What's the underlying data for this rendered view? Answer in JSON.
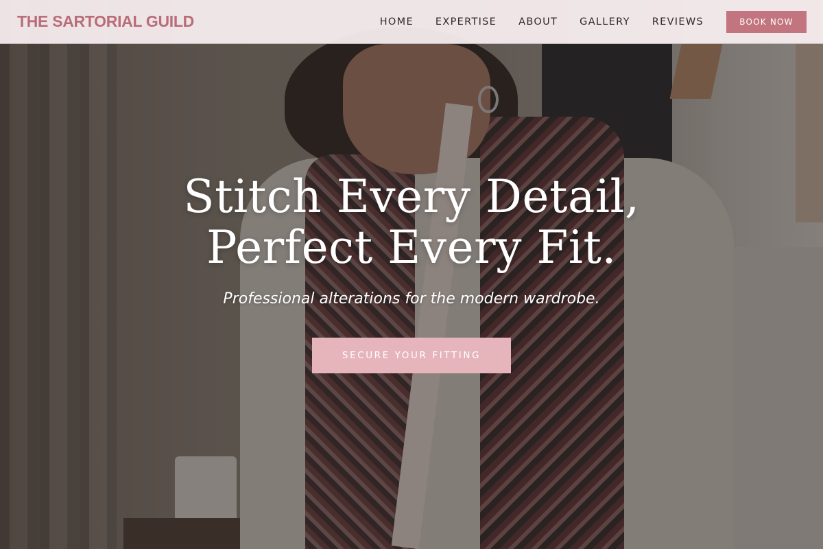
{
  "brand": {
    "name": "THE SARTORIAL GUILD",
    "color": "#b86d78"
  },
  "nav": {
    "items": [
      {
        "label": "HOME"
      },
      {
        "label": "EXPERTISE"
      },
      {
        "label": "ABOUT"
      },
      {
        "label": "GALLERY"
      },
      {
        "label": "REVIEWS"
      }
    ],
    "book_button": {
      "label": "BOOK NOW",
      "color": "#c2757f"
    }
  },
  "hero": {
    "headline": "Stitch Every Detail, Perfect Every Fit.",
    "subheadline": "Professional alterations for the modern wardrobe.",
    "cta": {
      "label": "SECURE YOUR FITTING",
      "color": "#e6b4bb"
    }
  }
}
